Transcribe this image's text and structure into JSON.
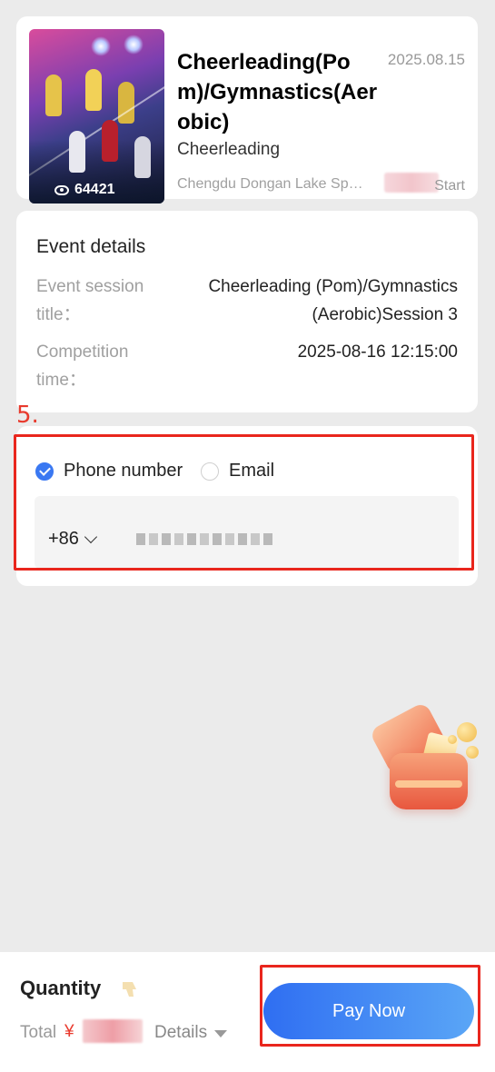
{
  "event": {
    "title": "Cheerleading(Pom)/Gymnastics(Aerobic)",
    "date": "2025.08.15",
    "sport": "Cheerleading",
    "venue": "Chengdu Dongan Lake Sp…",
    "start_suffix": "Start",
    "views": "64421"
  },
  "details": {
    "heading": "Event details",
    "session_label": "Event session title：",
    "session_value": "Cheerleading (Pom)/Gymnastics (Aerobic)Session 3",
    "time_label": "Competition time：",
    "time_value": "2025-08-16 12:15:00"
  },
  "contact": {
    "option_phone": "Phone number",
    "option_email": "Email",
    "selected": "phone",
    "country_code": "+86"
  },
  "annotation": {
    "step_label": "5.",
    "color": "#e9261d"
  },
  "footer": {
    "quantity_label": "Quantity",
    "total_label": "Total",
    "currency": "¥",
    "details_label": "Details",
    "pay_label": "Pay Now"
  },
  "colors": {
    "accent": "#3a78f2",
    "price": "#e93b2e",
    "background": "#ebebeb"
  }
}
